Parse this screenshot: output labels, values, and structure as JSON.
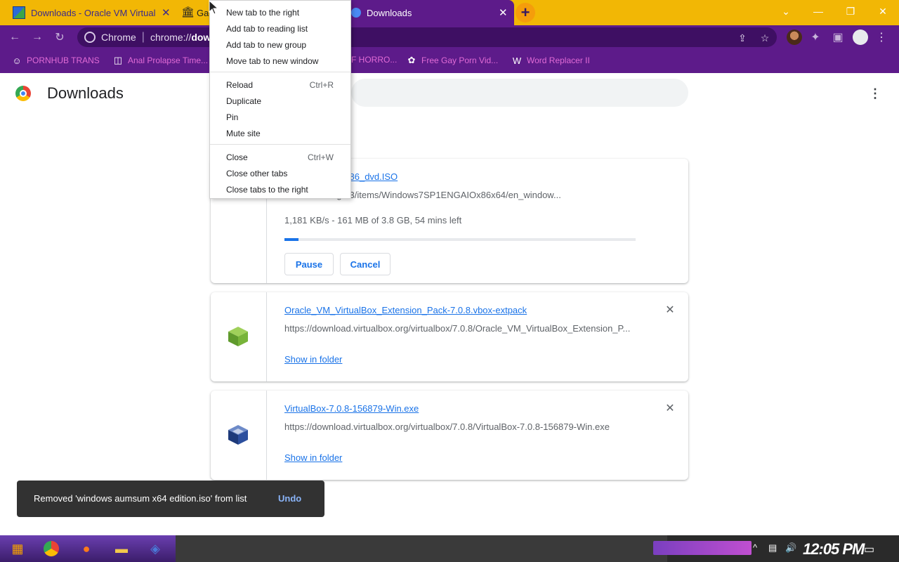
{
  "tabs": [
    {
      "title": "Downloads - Oracle VM VirtualBox",
      "close": "✕"
    },
    {
      "title": "Ga",
      "close": ""
    },
    {
      "title": "Downloads",
      "close": "✕"
    }
  ],
  "new_tab_label": "+",
  "window_controls": {
    "minimize": "⌄",
    "min": "—",
    "restore": "❐",
    "close": "✕"
  },
  "omnibox": {
    "site_label": "Chrome",
    "separator": "|",
    "url_prefix": "chrome://",
    "url_bold": "dow"
  },
  "bookmarks": [
    {
      "label": "PORNHUB TRANS",
      "icon": "☺"
    },
    {
      "label": "Anal Prolapse Time...",
      "icon": "◫"
    },
    {
      "label": "F HORRO...",
      "icon": ""
    },
    {
      "label": "Free Gay Porn Vid...",
      "icon": "✿"
    },
    {
      "label": "Word Replacer II",
      "icon": "W"
    }
  ],
  "page": {
    "title": "Downloads",
    "menu_icon": "⋮"
  },
  "downloads": [
    {
      "file_name": "AIO_sp1_x64_x86_dvd.ISO",
      "url": "us.archive.org/23/items/Windows7SP1ENGAIOx86x64/en_window...",
      "status": "1,181 KB/s - 161 MB of 3.8 GB, 54 mins left",
      "progress": 0.04,
      "pause_label": "Pause",
      "cancel_label": "Cancel"
    },
    {
      "file_name": "Oracle_VM_VirtualBox_Extension_Pack-7.0.8.vbox-extpack",
      "url": "https://download.virtualbox.org/virtualbox/7.0.8/Oracle_VM_VirtualBox_Extension_P...",
      "action": "Show in folder",
      "remove": "✕"
    },
    {
      "file_name": "VirtualBox-7.0.8-156879-Win.exe",
      "url": "https://download.virtualbox.org/virtualbox/7.0.8/VirtualBox-7.0.8-156879-Win.exe",
      "action": "Show in folder",
      "remove": "✕"
    }
  ],
  "context_menu": {
    "items": [
      {
        "label": "New tab to the right",
        "shortcut": ""
      },
      {
        "label": "Add tab to reading list",
        "shortcut": ""
      },
      {
        "label": "Add tab to new group",
        "shortcut": ""
      },
      {
        "label": "Move tab to new window",
        "shortcut": ""
      },
      {
        "label": "Reload",
        "shortcut": "Ctrl+R"
      },
      {
        "label": "Duplicate",
        "shortcut": ""
      },
      {
        "label": "Pin",
        "shortcut": ""
      },
      {
        "label": "Mute site",
        "shortcut": ""
      },
      {
        "label": "Close",
        "shortcut": "Ctrl+W"
      },
      {
        "label": "Close other tabs",
        "shortcut": ""
      },
      {
        "label": "Close tabs to the right",
        "shortcut": ""
      }
    ]
  },
  "toast": {
    "message": "Removed 'windows aumsum x64 edition.iso' from list",
    "undo": "Undo"
  },
  "taskbar": {
    "clock": "12:05 PM"
  },
  "colors": {
    "tab_strip": "#f2b705",
    "toolbar": "#5d1b8a",
    "bookmark_text": "#e16bd6",
    "link": "#1a73e8",
    "toast_bg": "#323232"
  }
}
